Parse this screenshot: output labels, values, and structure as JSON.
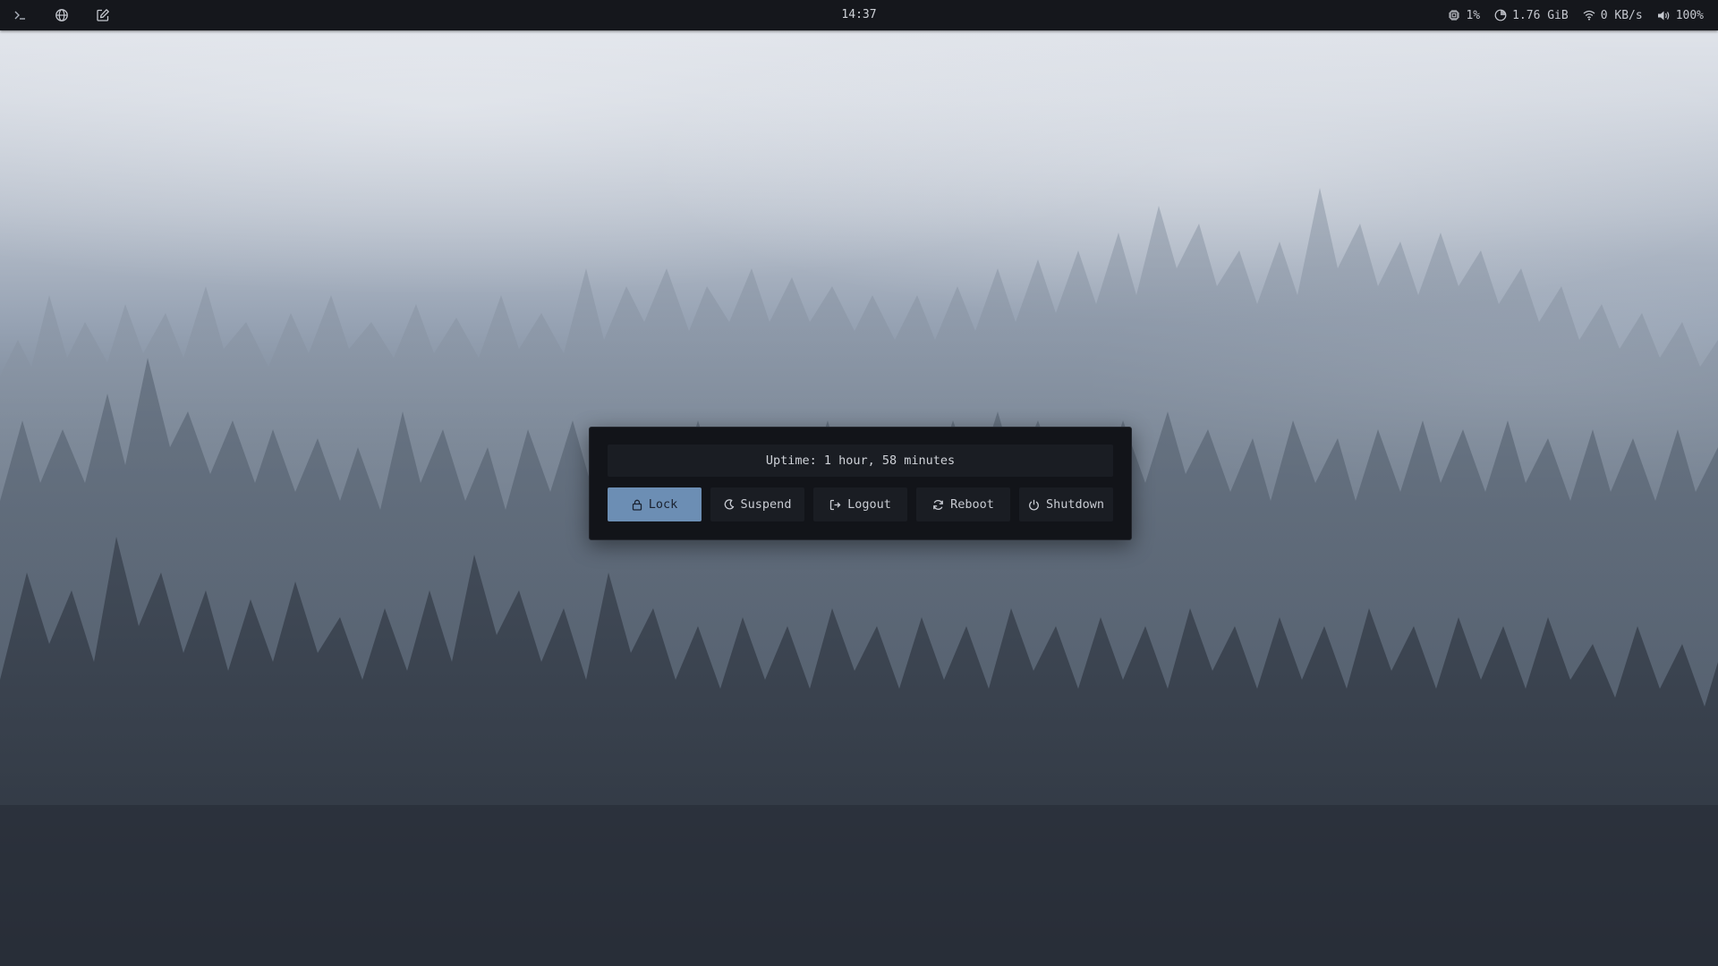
{
  "topbar": {
    "launchers": [
      {
        "icon": "terminal-icon"
      },
      {
        "icon": "globe-icon"
      },
      {
        "icon": "edit-icon"
      }
    ],
    "clock": "14:37",
    "stats": {
      "cpu": {
        "icon": "cpu-icon",
        "value": "1%"
      },
      "memory": {
        "icon": "memory-icon",
        "value": "1.76 GiB"
      },
      "network": {
        "icon": "wifi-icon",
        "value": "0 KB/s"
      },
      "volume": {
        "icon": "volume-icon",
        "value": "100%"
      }
    }
  },
  "power_menu": {
    "uptime": "Uptime: 1 hour, 58 minutes",
    "buttons": [
      {
        "label": "Lock",
        "icon": "lock-icon",
        "selected": true
      },
      {
        "label": "Suspend",
        "icon": "moon-icon",
        "selected": false
      },
      {
        "label": "Logout",
        "icon": "logout-icon",
        "selected": false
      },
      {
        "label": "Reboot",
        "icon": "reboot-icon",
        "selected": false
      },
      {
        "label": "Shutdown",
        "icon": "power-icon",
        "selected": false
      }
    ]
  },
  "colors": {
    "bar_bg": "#15171c",
    "dialog_bg": "#121419",
    "button_bg": "#1a1d23",
    "accent": "#6c8eb4",
    "text": "#c9ccd3"
  }
}
